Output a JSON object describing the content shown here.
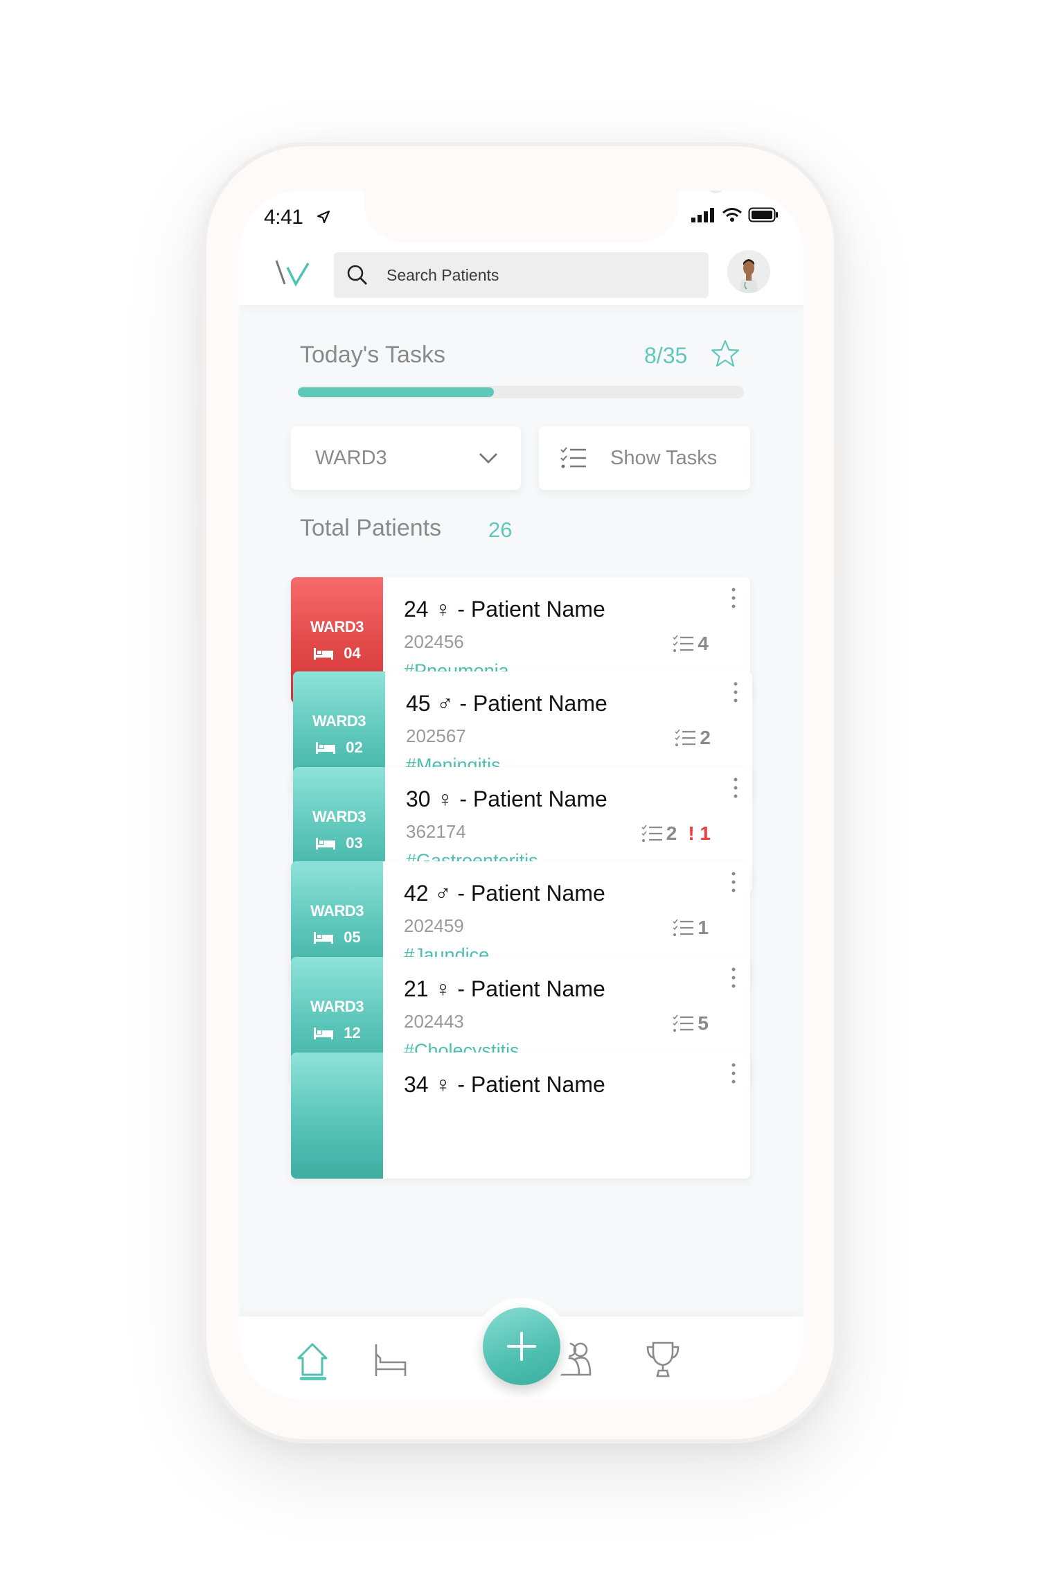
{
  "status_bar": {
    "time": "4:41",
    "icons": [
      "location-arrow-icon",
      "signal-icon",
      "wifi-icon",
      "battery-icon"
    ]
  },
  "header": {
    "logo": "app-logo",
    "search_placeholder": "Search Patients",
    "avatar": "doctor-avatar"
  },
  "tasks": {
    "title": "Today's Tasks",
    "completed": 8,
    "total": 35,
    "count_label": "8/35",
    "progress_fraction": 0.44
  },
  "filters": {
    "ward_select_value": "WARD3",
    "show_tasks_label": "Show Tasks"
  },
  "patients_summary": {
    "title": "Total Patients",
    "count": "26"
  },
  "colors": {
    "accent": "#5ec9bb",
    "critical": "#e34b4b",
    "alert": "#f03c3c"
  },
  "patients": [
    {
      "ward": "WARD3",
      "bed": "04",
      "title": "24 ♀ - Patient Name",
      "id": "202456",
      "tag": "#Pneumonia",
      "tasks": "4",
      "alerts": "",
      "status": "critical"
    },
    {
      "ward": "WARD3",
      "bed": "02",
      "title": "45 ♂ - Patient Name",
      "id": "202567",
      "tag": "#Meningitis",
      "tasks": "2",
      "alerts": "",
      "status": "normal"
    },
    {
      "ward": "WARD3",
      "bed": "03",
      "title": "30 ♀ - Patient Name",
      "id": "362174",
      "tag": "#Gastroenteritis",
      "tasks": "2",
      "alerts": "1",
      "status": "normal"
    },
    {
      "ward": "WARD3",
      "bed": "05",
      "title": "42 ♂ - Patient Name",
      "id": "202459",
      "tag": "#Jaundice",
      "tasks": "1",
      "alerts": "",
      "status": "normal"
    },
    {
      "ward": "WARD3",
      "bed": "12",
      "title": "21 ♀ - Patient Name",
      "id": "202443",
      "tag": "#Cholecystitis",
      "tasks": "5",
      "alerts": "",
      "status": "normal"
    },
    {
      "ward": "",
      "bed": "",
      "title": "34 ♀ - Patient Name",
      "id": "",
      "tag": "",
      "tasks": "",
      "alerts": "",
      "status": "normal"
    }
  ],
  "bottom_nav": {
    "items": [
      "home",
      "beds",
      "add",
      "patients",
      "achievements"
    ],
    "active": "home"
  }
}
